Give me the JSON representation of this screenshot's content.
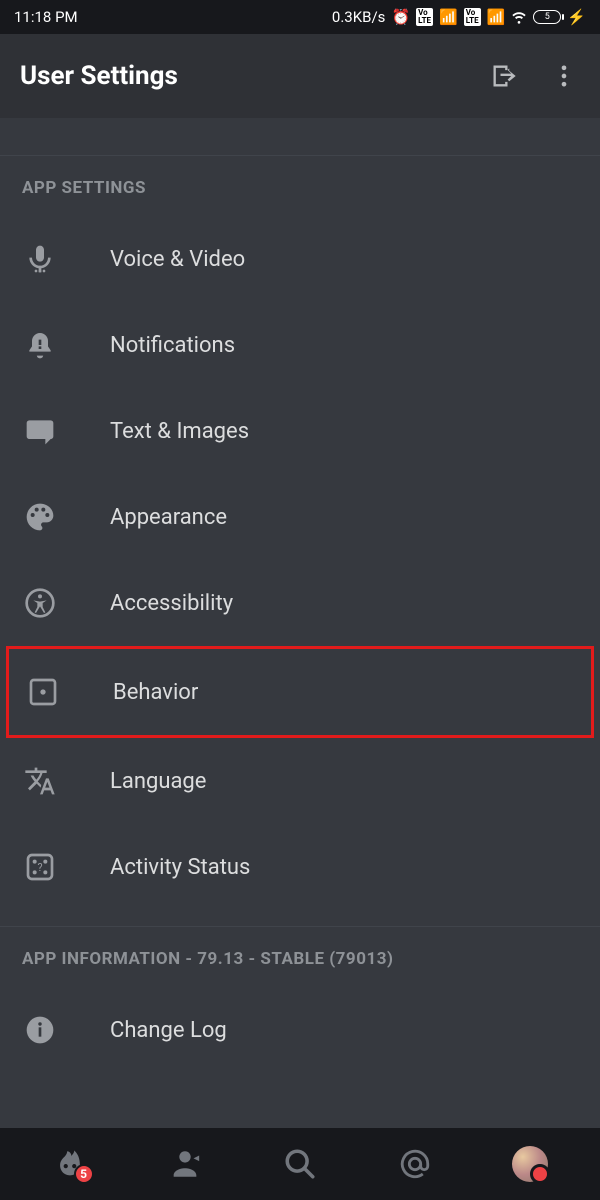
{
  "status": {
    "time": "11:18 PM",
    "net_speed": "0.3KB/s",
    "battery_text": "5"
  },
  "header": {
    "title": "User Settings"
  },
  "sections": {
    "app_settings_label": "APP SETTINGS",
    "items": [
      {
        "label": "Voice & Video"
      },
      {
        "label": "Notifications"
      },
      {
        "label": "Text & Images"
      },
      {
        "label": "Appearance"
      },
      {
        "label": "Accessibility"
      },
      {
        "label": "Behavior"
      },
      {
        "label": "Language"
      },
      {
        "label": "Activity Status"
      }
    ],
    "app_info_label": "APP INFORMATION - 79.13 - STABLE (79013)",
    "info_items": [
      {
        "label": "Change Log"
      }
    ]
  },
  "nav": {
    "badge_count": "5"
  },
  "highlighted_item": "Behavior"
}
